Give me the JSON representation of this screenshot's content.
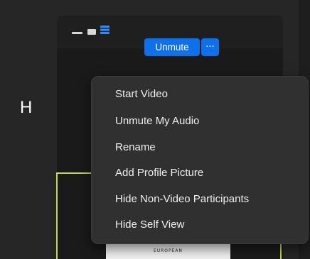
{
  "toolbar": {
    "layout_icons": [
      "speaker-view-icon",
      "gallery-view-icon",
      "strip-view-icon"
    ],
    "unmute_label": "Unmute",
    "more_label": "···"
  },
  "video": {
    "participant_name_partial": "H",
    "logo_small_text": "EUROPEAN"
  },
  "menu": {
    "items": [
      {
        "label": "Start Video"
      },
      {
        "label": "Unmute My Audio"
      },
      {
        "label": "Rename"
      },
      {
        "label": "Add Profile Picture"
      },
      {
        "label": "Hide Non-Video Participants"
      },
      {
        "label": "Hide Self View"
      }
    ]
  },
  "colors": {
    "accent": "#0e71eb",
    "active_speaker": "#c5d94e",
    "menu_bg": "#303030"
  }
}
